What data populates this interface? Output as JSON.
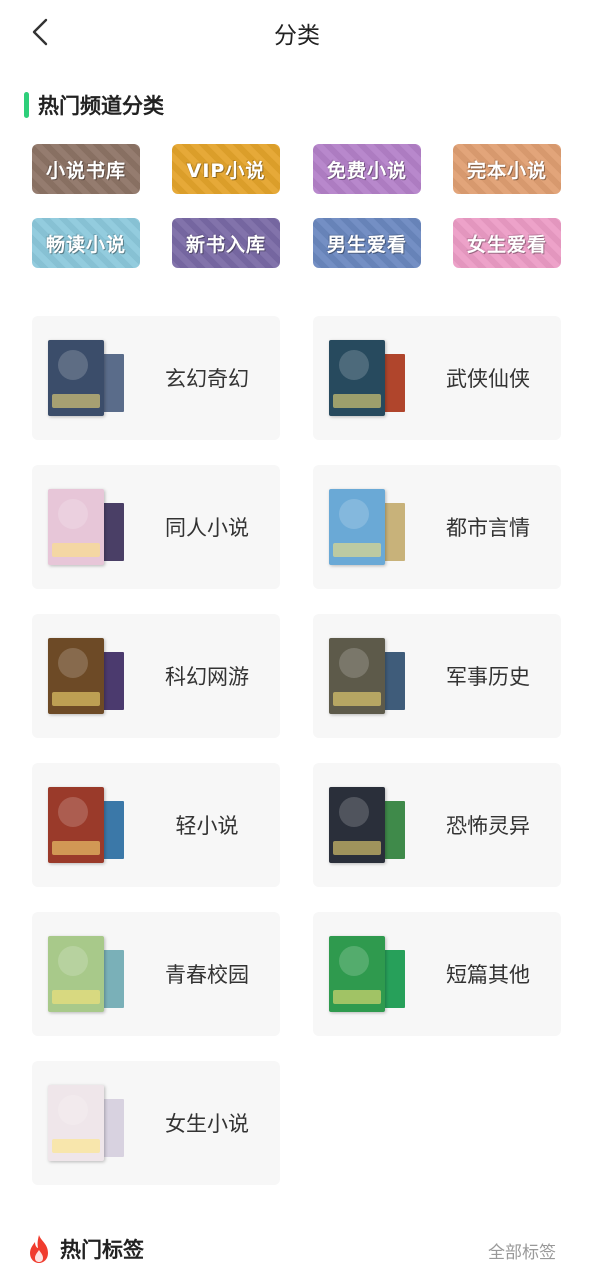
{
  "header": {
    "title": "分类",
    "back_icon": "chevron-left-icon"
  },
  "hot_channels": {
    "title": "热门频道分类",
    "accent_color": "#2ecf7a",
    "items": [
      {
        "label": "小说书库",
        "color": "#8e7466"
      },
      {
        "label": "VIP小说",
        "color": "#e4a42c"
      },
      {
        "label": "免费小说",
        "color": "#b481c9"
      },
      {
        "label": "完本小说",
        "color": "#e09f72"
      },
      {
        "label": "畅读小说",
        "color": "#8cc9dc"
      },
      {
        "label": "新书入库",
        "color": "#7a6aa6"
      },
      {
        "label": "男生爱看",
        "color": "#6b88c0"
      },
      {
        "label": "女生爱看",
        "color": "#ec9cc6"
      }
    ]
  },
  "categories": [
    {
      "label": "玄幻奇幻",
      "cover_front": "#3b4d6a",
      "cover_back": "#5a6c8a"
    },
    {
      "label": "武侠仙侠",
      "cover_front": "#274a5e",
      "cover_back": "#b0452c"
    },
    {
      "label": "同人小说",
      "cover_front": "#e7c6d8",
      "cover_back": "#4a3f66"
    },
    {
      "label": "都市言情",
      "cover_front": "#6aa9d6",
      "cover_back": "#c8b27a"
    },
    {
      "label": "科幻网游",
      "cover_front": "#6d4a26",
      "cover_back": "#4b3a6e"
    },
    {
      "label": "军事历史",
      "cover_front": "#5d5a4a",
      "cover_back": "#3f5c7a"
    },
    {
      "label": "轻小说",
      "cover_front": "#9a3a2a",
      "cover_back": "#3b78a8"
    },
    {
      "label": "恐怖灵异",
      "cover_front": "#2a2f3a",
      "cover_back": "#3f8a4a"
    },
    {
      "label": "青春校园",
      "cover_front": "#a8c98a",
      "cover_back": "#7ab0b8"
    },
    {
      "label": "短篇其他",
      "cover_front": "#2f9a4e",
      "cover_back": "#27a05a"
    },
    {
      "label": "女生小说",
      "cover_front": "#efe6ea",
      "cover_back": "#d8d2e0"
    }
  ],
  "hot_tags": {
    "title": "热门标签",
    "all_label": "全部标签",
    "icon": "flame-icon",
    "icon_color": "#f03c2e"
  }
}
